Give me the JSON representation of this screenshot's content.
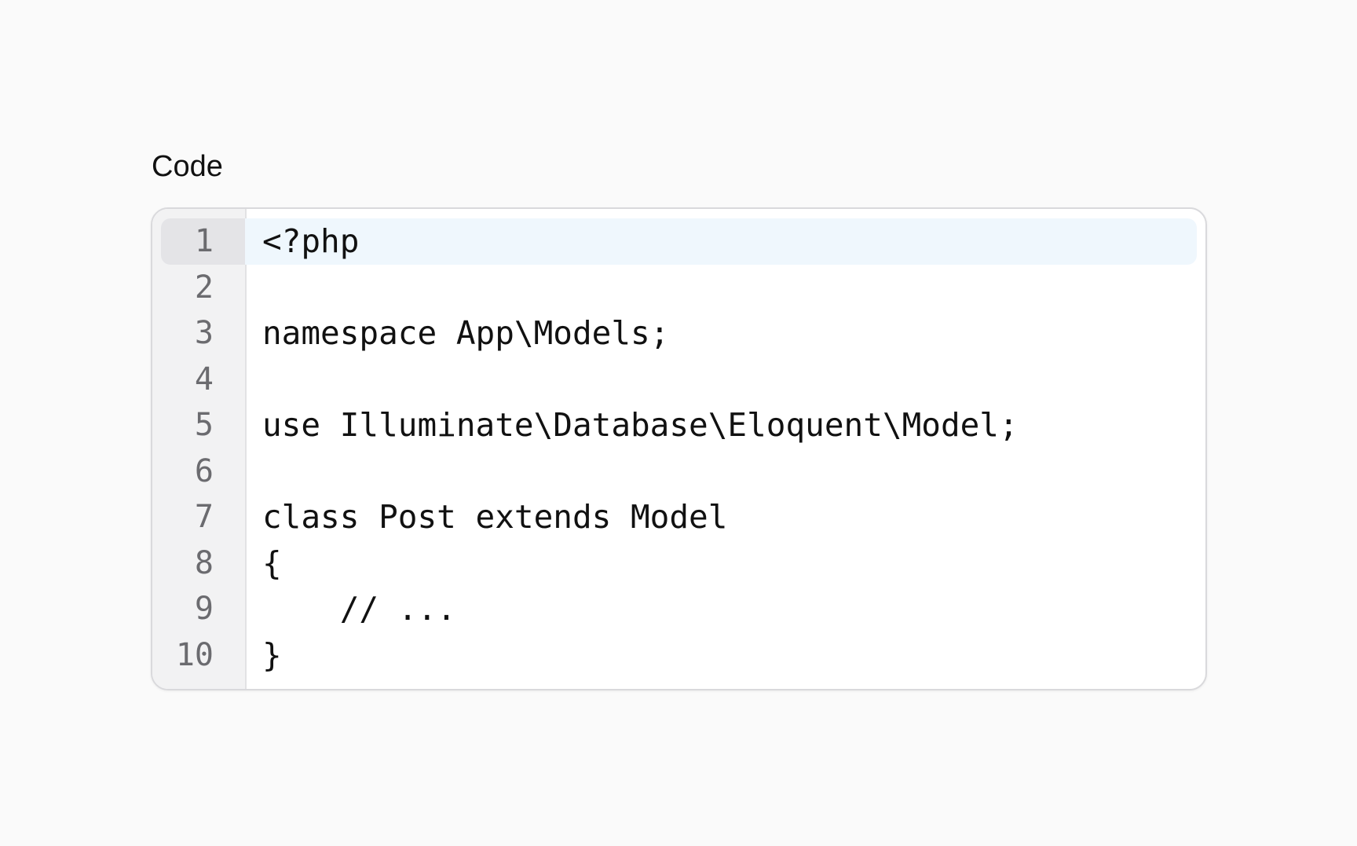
{
  "field": {
    "label": "Code"
  },
  "editor": {
    "active_line": 1,
    "lines": [
      {
        "number": "1",
        "text": "<?php"
      },
      {
        "number": "2",
        "text": ""
      },
      {
        "number": "3",
        "text": "namespace App\\Models;"
      },
      {
        "number": "4",
        "text": ""
      },
      {
        "number": "5",
        "text": "use Illuminate\\Database\\Eloquent\\Model;"
      },
      {
        "number": "6",
        "text": ""
      },
      {
        "number": "7",
        "text": "class Post extends Model"
      },
      {
        "number": "8",
        "text": "{"
      },
      {
        "number": "9",
        "text": "    // ..."
      },
      {
        "number": "10",
        "text": "}"
      }
    ]
  },
  "colors": {
    "active_line_background": "#eff7fd",
    "gutter_background": "#f2f2f3",
    "page_background": "#fafafa"
  }
}
